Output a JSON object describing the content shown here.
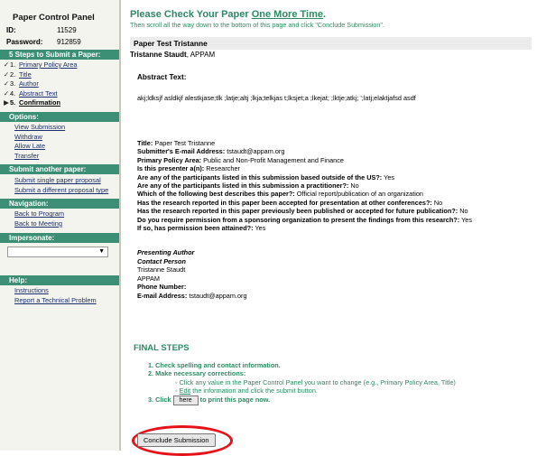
{
  "sidebar": {
    "title": "Paper Control Panel",
    "id_label": "ID:",
    "id_value": "11529",
    "password_label": "Password:",
    "password_value": "912859",
    "steps_heading": "5 Steps to Submit a Paper:",
    "steps": [
      {
        "mark": "✓",
        "num": "1.",
        "label": "Primary Policy Area"
      },
      {
        "mark": "✓",
        "num": "2.",
        "label": "Title"
      },
      {
        "mark": "✓",
        "num": "3.",
        "label": "Author"
      },
      {
        "mark": "✓",
        "num": "4.",
        "label": "Abstract Text"
      },
      {
        "mark": "▶",
        "num": "5.",
        "label": "Confirmation"
      }
    ],
    "options_heading": "Options:",
    "options": [
      "View Submission",
      "Withdraw",
      "Allow Late",
      "Transfer"
    ],
    "another_heading": "Submit another paper:",
    "another": [
      "Submit single paper proposal",
      "Submit a different proposal type"
    ],
    "nav_heading": "Navigation:",
    "nav": [
      "Back to Program",
      "Back to Meeting"
    ],
    "impersonate_heading": "Impersonate:",
    "impersonate_value": "",
    "help_heading": "Help:",
    "help": [
      "Instructions",
      "Report a Technical Problem"
    ]
  },
  "header": {
    "title_pre": "Please Check Your Paper ",
    "title_em": "One More Time",
    "title_post": ".",
    "subtitle": "Then scroll all the way down to the bottom of this page and click \"Conclude Submission\"."
  },
  "paper": {
    "heading": "Paper Test Tristanne",
    "author_name": "Tristanne Staudt",
    "author_org": ", APPAM",
    "abstract_label": "Abstract Text:",
    "abstract_text": "akj;ldksjf asldkjf    alestkjase;tlk ;latje;altj ;lkja;telkjas t;lksjet;a ;lkejat; ;lktje;atkj; ';latj;elaktjafsd asdf"
  },
  "details": [
    {
      "k": "Title:",
      "v": " Paper Test Tristanne"
    },
    {
      "k": "Submitter's E-mail Address:",
      "v": " tstaudt@appam.org"
    },
    {
      "k": "Primary Policy Area:",
      "v": " Public and Non-Profit Management and Finance"
    },
    {
      "k": "Is this presenter a(n):",
      "v": " Researcher"
    },
    {
      "k": "Are any of the participants listed in this submission based outside of the US?:",
      "v": " Yes"
    },
    {
      "k": "Are any of the participants listed in this submission a practitioner?:",
      "v": " No"
    },
    {
      "k": "Which of the following best describes this paper?:",
      "v": " Official report/publication of an organization"
    },
    {
      "k": "Has the research reported in this paper been accepted for presentation at other conferences?:",
      "v": " No"
    },
    {
      "k": "Has the research reported in this paper previously been published or accepted for future publication?:",
      "v": " No"
    },
    {
      "k": "Do you require permission from a sponsoring organization to present the findings from this research?:",
      "v": " Yes"
    },
    {
      "k": "If so, has permission been attained?:",
      "v": " Yes"
    }
  ],
  "contact": {
    "role": "Presenting Author",
    "role2": "Contact Person",
    "name": "Tristanne Staudt",
    "org": "APPAM",
    "phone_label": "Phone Number:",
    "email_label": "E-mail Address:",
    "email_value": " tstaudt@appam.org"
  },
  "final": {
    "title": "FINAL STEPS",
    "step1": "1.  Check spelling and contact information.",
    "step2": "2.  Make necessary corrections:",
    "bullet1": "◦  Click any value in the Paper Control Panel you want to change (e.g., Primary Policy Area, Title)",
    "bullet2_pre": "◦  ",
    "bullet2_link": "Edit",
    "bullet2_post": " the information and click the submit button.",
    "step3_pre": "3.  Click",
    "here_label": "here",
    "step3_post": " to print this page now.",
    "conclude_label": "Conclude Submission"
  },
  "colors": {
    "accent_green": "#2e8a63",
    "sidebar_header": "#3c8f74",
    "highlight_ring": "#e5121a"
  }
}
